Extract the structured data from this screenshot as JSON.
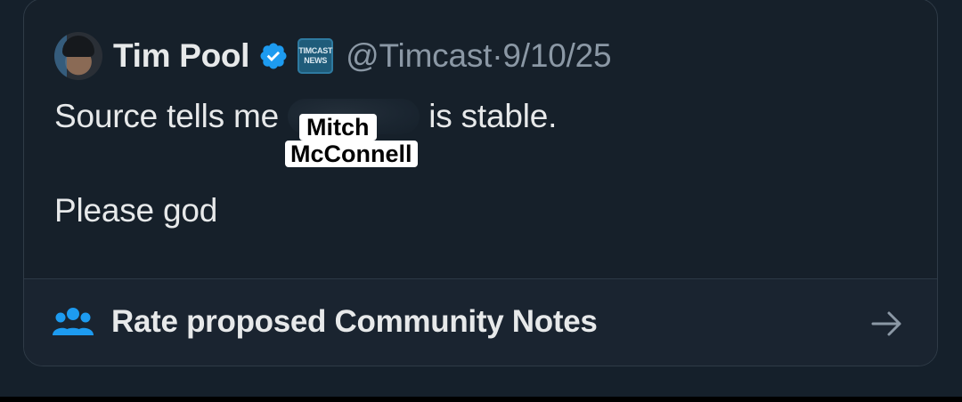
{
  "tweet": {
    "author": {
      "display_name": "Tim Pool",
      "verified_icon": "verified-badge-icon",
      "org_badge_text_line1": "TIMCAST",
      "org_badge_text_line2": "NEWS",
      "handle_and_date": "@Timcast·9/10/25"
    },
    "text": {
      "line1_before": "Source tells me",
      "line1_after": "is stable.",
      "line2": "Please god"
    },
    "overlay_labels": {
      "first": "Mitch",
      "second": "McConnell"
    }
  },
  "community_notes": {
    "label": "Rate proposed Community Notes",
    "icon": "people-icon",
    "arrow_icon": "arrow-right-icon"
  },
  "colors": {
    "background": "#15202b",
    "text_primary": "#e7e9ea",
    "text_secondary": "#8b98a5",
    "accent": "#1d9bf0"
  }
}
